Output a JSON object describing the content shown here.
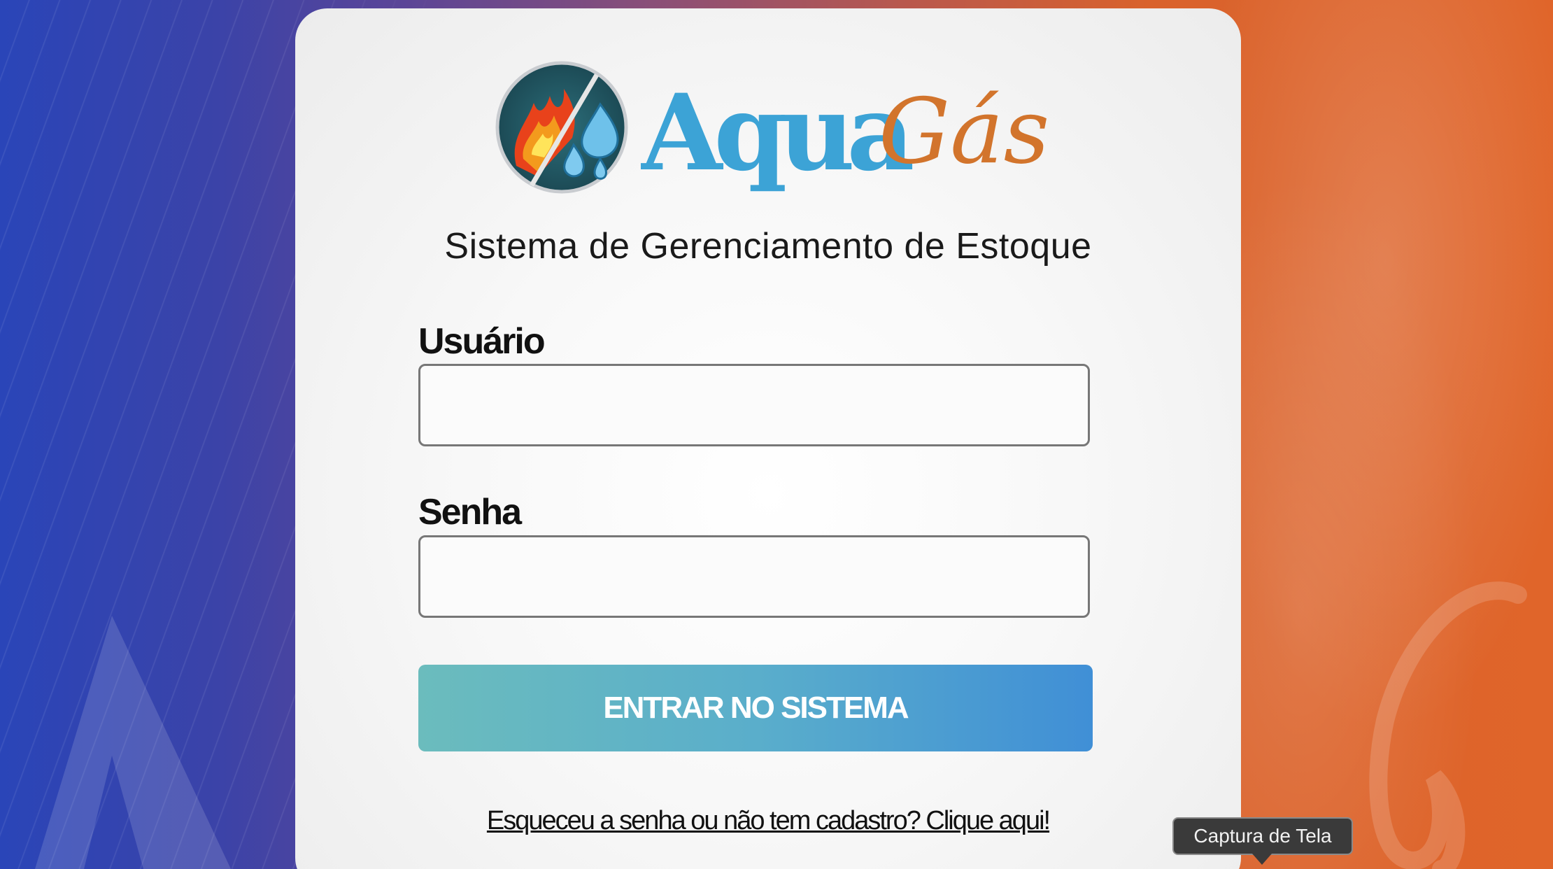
{
  "brand": {
    "name_part1": "Aqua",
    "name_part2": "Gás",
    "color_aqua": "#3ca3d6",
    "color_gas": "#d2742c"
  },
  "login": {
    "subtitle": "Sistema de Gerenciamento de Estoque",
    "username_label": "Usuário",
    "username_value": "",
    "password_label": "Senha",
    "password_value": "",
    "submit_label": "ENTRAR NO SISTEMA",
    "forgot_link": "Esqueceu a senha ou não tem cadastro? Clique aqui!"
  },
  "tooltip": {
    "text": "Captura de Tela"
  },
  "icons": {
    "emblem": "fire-water-emblem-icon"
  },
  "colors": {
    "background_left": "#2a45b8",
    "background_right": "#e0652a",
    "button_start": "#6bbcbd",
    "button_end": "#408fd6"
  }
}
